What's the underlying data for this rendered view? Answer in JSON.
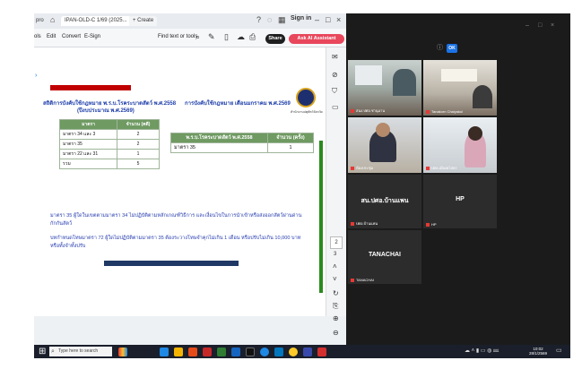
{
  "browser": {
    "tab_prefix": "pro",
    "active_tab": "IPAN-OLD-C 1/69 (2025...",
    "new_tab": "+ Create",
    "sign_in": "Sign in"
  },
  "pdf_toolbar": {
    "menus": [
      "ols",
      "Edit",
      "Convert",
      "E-Sign"
    ],
    "find": "Find text or tools",
    "share": "Share",
    "ai": "Ask AI Assistant"
  },
  "document": {
    "heading_left": "สถิติการบังคับใช้กฎหมาย พ.ร.บ.โรคระบาดสัตว์ พ.ศ.2558",
    "heading_left_sub": "(ปีงบประมาณ พ.ศ.2569)",
    "heading_right": "การบังคับใช้กฎหมาย เดือนมกราคม พ.ศ.2569",
    "seal_caption": "สำนักงานปศุสัตว์จังหวัด",
    "table1": {
      "headers": [
        "มาตรา",
        "จำนวน (คดี)"
      ],
      "rows": [
        [
          "มาตรา 34 และ 3",
          "2"
        ],
        [
          "มาตรา 35",
          "2"
        ],
        [
          "มาตรา 22 และ 31",
          "1"
        ],
        [
          "รวม",
          "5"
        ]
      ]
    },
    "table2": {
      "headers": [
        "พ.ร.บ.โรคระบาดสัตว์ พ.ศ.2558",
        "จำนวน (ครั้ง)"
      ],
      "rows": [
        [
          "มาตรา 35",
          "1"
        ]
      ]
    },
    "para1": "มาตรา 35 ผู้ใดในเขตตามมาตรา 34 ไม่ปฏิบัติตามหลักเกณฑ์วิธีการ และเงื่อนไขในการนำเข้าหรือส่งออกสัตว์ผ่านด่านกักกันสัตว์",
    "para2": "บทกำหนดโทษมาตรา 72 ผู้ใดไม่ปฏิบัติตามมาตรา 35 ต้องระวางโทษจำคุกไม่เกิน 1 เดือน หรือปรับไม่เกิน 10,000 บาท หรือทั้งจำทั้งปรับ",
    "page_number": "2",
    "page_total": "3"
  },
  "meeting": {
    "ok_label": "OK",
    "video_tiles": [
      {
        "label": "สนง.ปศอ.ชานุมาน"
      },
      {
        "label": "Tanakorn Chaiyakul"
      },
      {
        "label": "ห้องประชุม"
      },
      {
        "label": "ปศอ.เมืองยโสธร"
      }
    ],
    "name_tiles": [
      {
        "name": "สน.ปศอ.บ้านแพน",
        "label": "ปศอ.บ้านแพน"
      },
      {
        "name": "HP",
        "label": "HP"
      },
      {
        "name": "TANACHAI",
        "label": "TANACHAI"
      }
    ]
  },
  "taskbar": {
    "search_placeholder": "Type here to search",
    "time": "10:02",
    "date": "28/1/2569"
  },
  "colors": {
    "accent_red": "#c00000",
    "table_green": "#6f9a62",
    "text_blue": "#2a40b0",
    "ai_button": "#e8475c"
  }
}
